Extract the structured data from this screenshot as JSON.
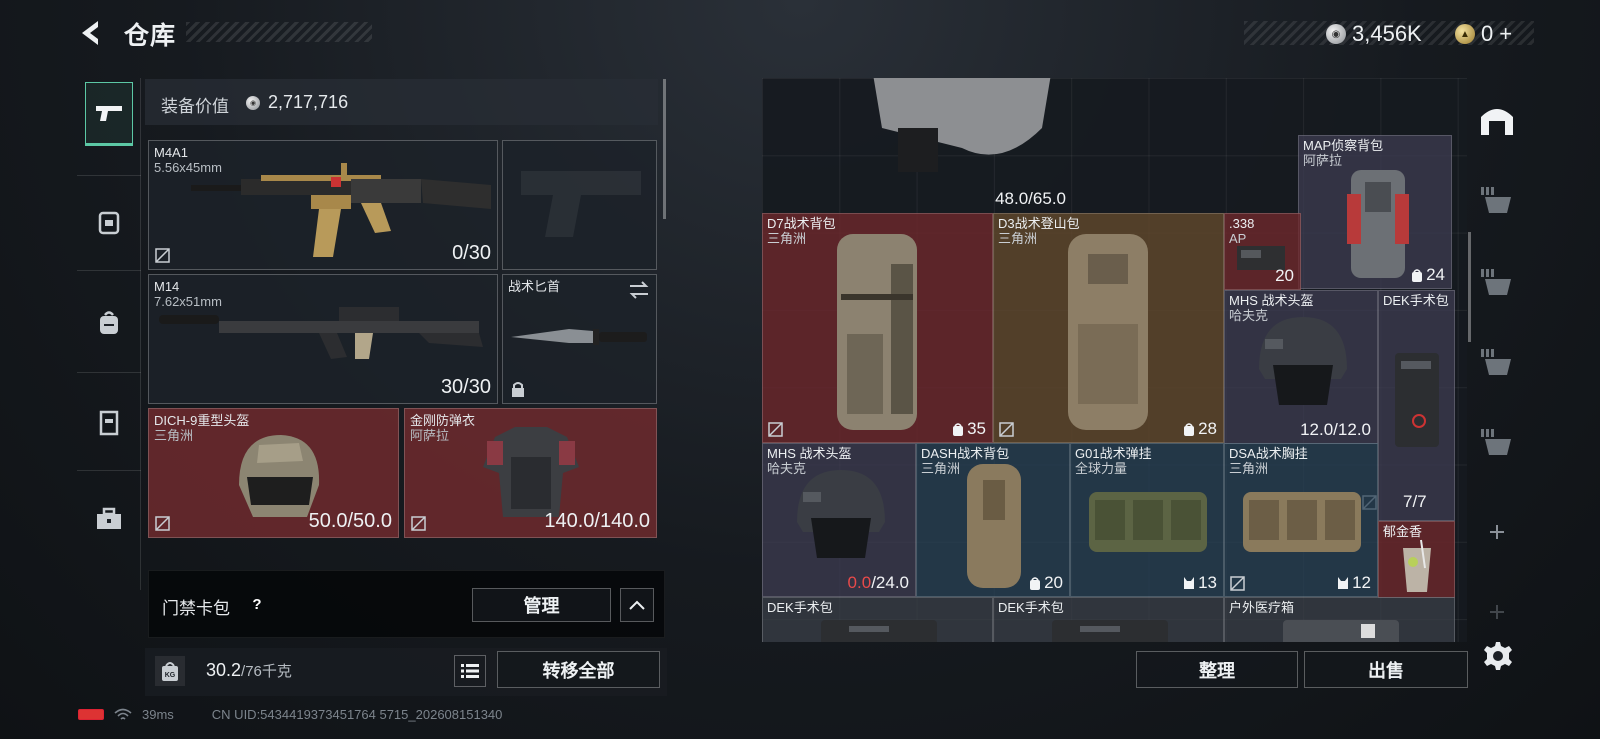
{
  "header": {
    "title": "仓库",
    "silver_amount": "3,456K",
    "gold_amount": "0",
    "gold_plus": "+"
  },
  "loadout": {
    "value_label": "装备价值",
    "value": "2,717,716",
    "primary": {
      "name": "M4A1",
      "caliber": "5.56x45mm",
      "ammo": "0/30"
    },
    "secondary": {
      "name": "M14",
      "caliber": "7.62x51mm",
      "ammo": "30/30"
    },
    "melee": {
      "name": "战术匕首"
    },
    "helmet": {
      "name": "DICH-9重型头盔",
      "faction": "三角洲",
      "durability": "50.0/50.0"
    },
    "armor": {
      "name": "金刚防弹衣",
      "faction": "阿萨拉",
      "durability": "140.0/140.0"
    },
    "card_pack_label": "门禁卡包",
    "card_pack_help": "?",
    "manage_label": "管理",
    "weight_current": "30.2",
    "weight_max": "/76千克",
    "kg_label": "KG",
    "transfer_all_label": "转移全部"
  },
  "stash": {
    "items": [
      {
        "id": "top-backpack",
        "count": "48.0/65.0",
        "color": "gray"
      },
      {
        "id": "map-backpack",
        "name": "MAP侦察背包",
        "sub": "阿萨拉",
        "count": "24",
        "color": "purple"
      },
      {
        "id": "d7-backpack",
        "name": "D7战术背包",
        "sub": "三角洲",
        "count": "35",
        "color": "red"
      },
      {
        "id": "d3-backpack",
        "name": "D3战术登山包",
        "sub": "三角洲",
        "count": "28",
        "color": "brown"
      },
      {
        "id": "ap-ammo",
        "name": ".338",
        "sub": "AP",
        "count": "20",
        "color": "red"
      },
      {
        "id": "mhs-helmet-1",
        "name": "MHS 战术头盔",
        "sub": "哈夫克",
        "count": "12.0/12.0",
        "color": "purple"
      },
      {
        "id": "dek-kit-1",
        "name": "DEK手术包",
        "sub": "",
        "count": "7/7",
        "color": "purple"
      },
      {
        "id": "mhs-helmet-2",
        "name": "MHS 战术头盔",
        "sub": "哈夫克",
        "count_red": "0.0",
        "count_rest": "/24.0",
        "color": "purple"
      },
      {
        "id": "dash-backpack",
        "name": "DASH战术背包",
        "sub": "三角洲",
        "count": "20",
        "color": "blue"
      },
      {
        "id": "g01-rig",
        "name": "G01战术弹挂",
        "sub": "全球力量",
        "count": "13",
        "color": "blue"
      },
      {
        "id": "dsa-rig",
        "name": "DSA战术胸挂",
        "sub": "三角洲",
        "count": "12",
        "color": "blue"
      },
      {
        "id": "tulip-drink",
        "name": "郁金香",
        "sub": "",
        "count": "",
        "color": "red"
      },
      {
        "id": "dek-kit-2",
        "name": "DEK手术包",
        "color": "gray"
      },
      {
        "id": "dek-kit-3",
        "name": "DEK手术包",
        "color": "gray"
      },
      {
        "id": "outdoor-med",
        "name": "户外医疗箱",
        "color": "gray"
      }
    ],
    "sort_label": "整理",
    "sell_label": "出售"
  },
  "status_bar": {
    "ping": "39ms",
    "uid": "CN UID:5434419373451764 5715_202608151340"
  }
}
